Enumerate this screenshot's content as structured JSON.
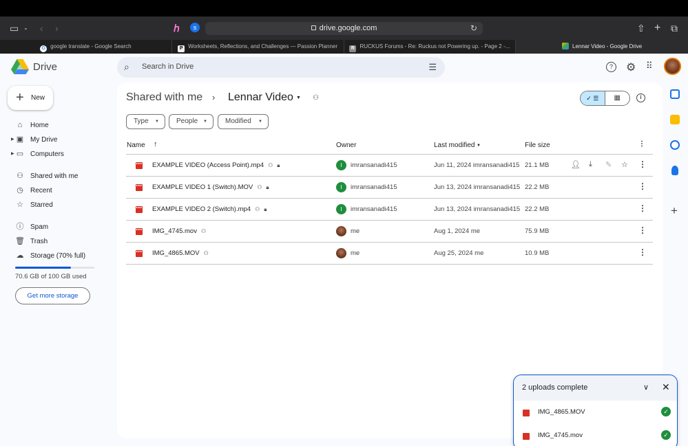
{
  "browser": {
    "url": "drive.google.com",
    "tabs": [
      {
        "label": "google translate - Google Search",
        "active": false
      },
      {
        "label": "Worksheets, Reflections, and Challenges — Passion Planner",
        "active": false
      },
      {
        "label": "RUCKUS Forums - Re: Ruckus not Powering up. - Page 2 -...",
        "active": false
      },
      {
        "label": "Lennar Video - Google Drive",
        "active": true
      }
    ]
  },
  "app": {
    "name": "Drive"
  },
  "sidebar": {
    "new_label": "New",
    "items": [
      {
        "label": "Home",
        "icon": "home-icon"
      },
      {
        "label": "My Drive",
        "icon": "my-drive-icon"
      },
      {
        "label": "Computers",
        "icon": "computer-icon"
      },
      {
        "label": "Shared with me",
        "icon": "people-icon"
      },
      {
        "label": "Recent",
        "icon": "clock-icon"
      },
      {
        "label": "Starred",
        "icon": "star-icon"
      },
      {
        "label": "Spam",
        "icon": "spam-icon"
      },
      {
        "label": "Trash",
        "icon": "trash-icon"
      },
      {
        "label": "Storage (70% full)",
        "icon": "cloud-icon"
      }
    ],
    "storage_fraction": 0.7,
    "storage_used": "70.6 GB of 100 GB used",
    "get_storage_label": "Get more storage"
  },
  "search": {
    "placeholder": "Search in Drive"
  },
  "breadcrumb": {
    "parent": "Shared with me",
    "current": "Lennar Video"
  },
  "filters": [
    "Type",
    "People",
    "Modified"
  ],
  "table": {
    "headers": {
      "name": "Name",
      "owner": "Owner",
      "modified": "Last modified",
      "size": "File size"
    },
    "rows": [
      {
        "name": "EXAMPLE VIDEO (Access Point).mp4",
        "owner": "imransanadi415",
        "owner_initial": "I",
        "modified": "Jun 11, 2024  imransanadi415",
        "size": "21.1 MB"
      },
      {
        "name": "EXAMPLE VIDEO 1 (Switch).MOV",
        "owner": "imransanadi415",
        "owner_initial": "I",
        "modified": "Jun 13, 2024  imransanadi415",
        "size": "22.2 MB"
      },
      {
        "name": "EXAMPLE VIDEO 2 (Switch).mp4",
        "owner": "imransanadi415",
        "owner_initial": "I",
        "modified": "Jun 13, 2024  imransanadi415",
        "size": "22.2 MB"
      },
      {
        "name": "IMG_4745.mov",
        "owner": "me",
        "owner_initial": "",
        "modified": "Aug 1, 2024  me",
        "size": "75.9 MB"
      },
      {
        "name": "IMG_4865.MOV",
        "owner": "me",
        "owner_initial": "",
        "modified": "Aug 25, 2024  me",
        "size": "10.9 MB"
      }
    ]
  },
  "uploads": {
    "title": "2 uploads complete",
    "items": [
      "IMG_4865.MOV",
      "IMG_4745.mov"
    ]
  },
  "colors": {
    "accent": "#0b57d0",
    "file_video": "#d93025",
    "success": "#1e8e3e"
  }
}
